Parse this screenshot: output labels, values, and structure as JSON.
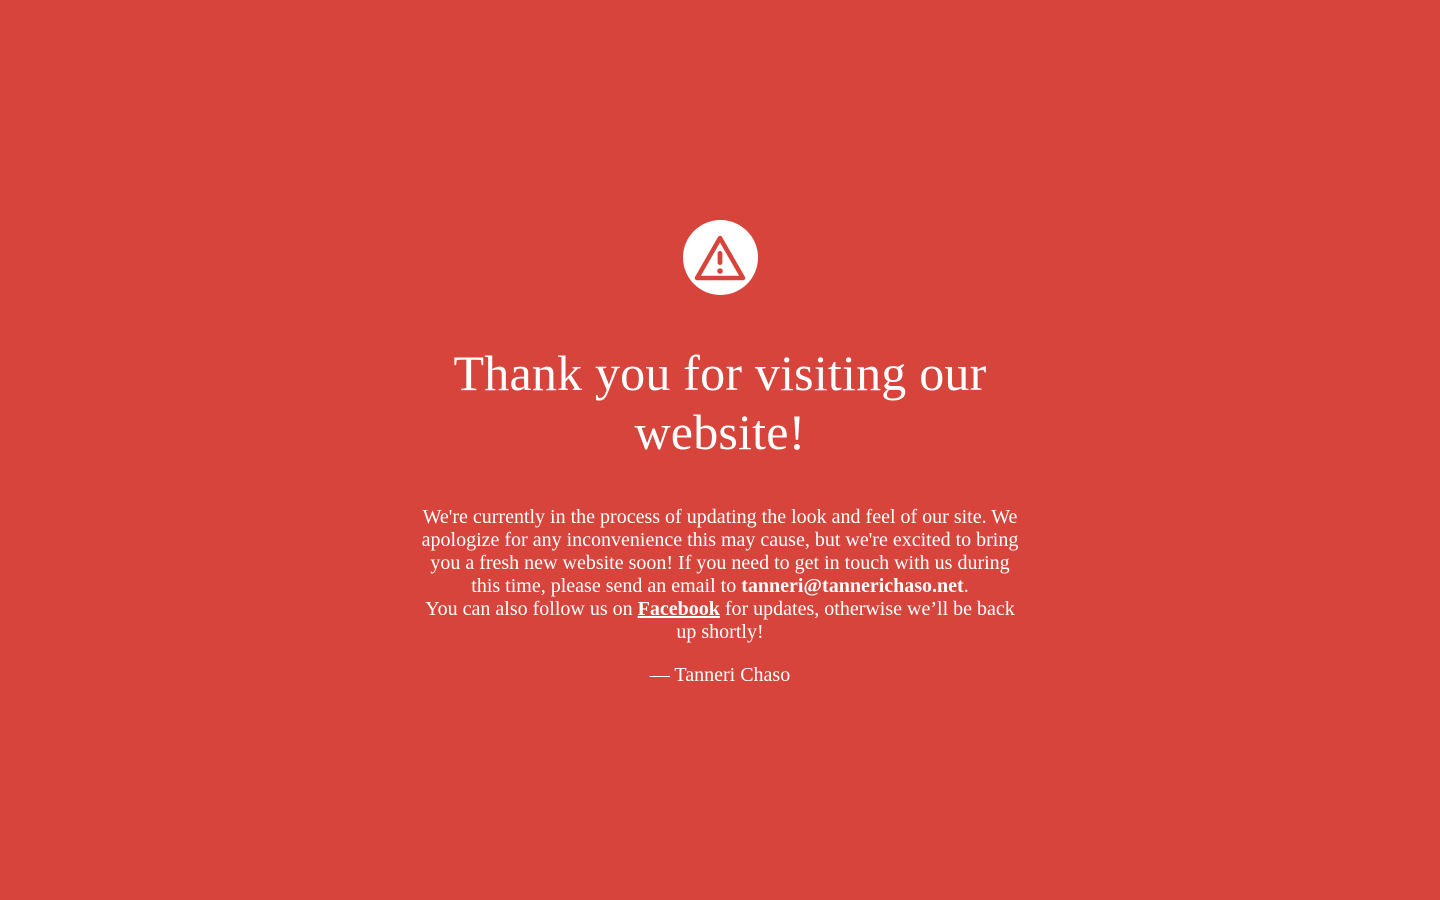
{
  "icon": "warning-triangle-icon",
  "colors": {
    "background": "#d6443b",
    "text": "#ffffff",
    "icon_circle": "#ffffff",
    "icon_glyph": "#d6443b"
  },
  "headline": "Thank you for visiting our website!",
  "message": {
    "intro": "We're currently in the process of updating the look and feel of our site. We apologize for any inconvenience this may cause, but we're excited to bring you a fresh new website soon! If you need to get in touch with us during this time, please send an email to ",
    "email": "tanneri@tannerichaso.net",
    "email_suffix": ".",
    "follow_prefix": "You can also follow us on ",
    "facebook_label": "Facebook",
    "follow_suffix": " for updates, otherwise we’ll be back up shortly!"
  },
  "signature": "— Tanneri Chaso"
}
